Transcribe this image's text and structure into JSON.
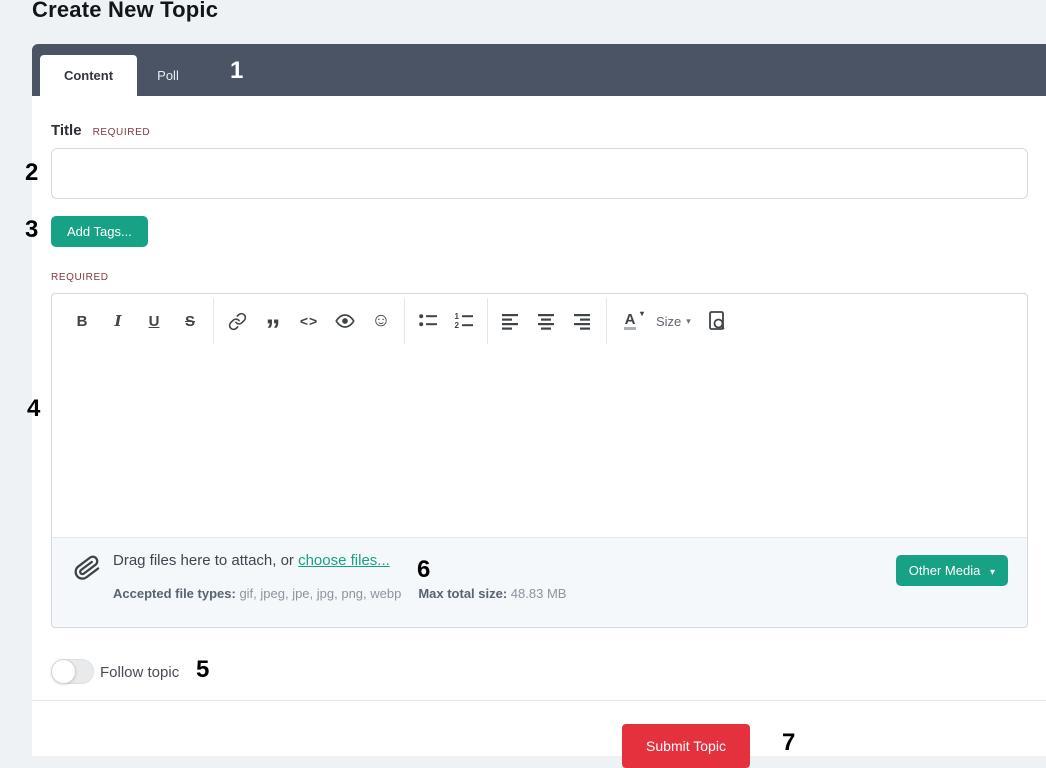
{
  "page": {
    "title": "Create New Topic"
  },
  "tabs": {
    "content_label": "Content",
    "poll_label": "Poll"
  },
  "annotations": {
    "n1": "1",
    "n2": "2",
    "n3": "3",
    "n4": "4",
    "n5": "5",
    "n6": "6",
    "n7": "7"
  },
  "form": {
    "title_label": "Title",
    "title_required_label": "REQUIRED",
    "title_value": "",
    "add_tags_button": "Add Tags...",
    "editor_required_label": "REQUIRED"
  },
  "editor": {
    "toolbar": {
      "bold": "B",
      "italic": "I",
      "underline": "U",
      "strike": "S",
      "quote_glyph": "”",
      "code_glyph": "<>",
      "emoji_glyph": "☺",
      "font_color_letter": "A",
      "size_label": "Size",
      "caret_down": "▾"
    }
  },
  "attachments": {
    "drag_text": "Drag files here to attach, or ",
    "choose_files_link": "choose files...",
    "accepted_label": "Accepted file types: ",
    "accepted_types": "gif, jpeg, jpe, jpg, png, webp",
    "max_size_label": "Max total size: ",
    "max_size_value": "48.83 MB",
    "other_media_button": "Other Media",
    "caret_down": "▾"
  },
  "follow": {
    "label": "Follow topic"
  },
  "footer": {
    "submit_button": "Submit Topic"
  },
  "icons": [
    "link-icon",
    "quote-icon",
    "code-icon",
    "eye-icon",
    "emoji-icon",
    "bulleted-list-icon",
    "numbered-list-icon",
    "align-left-icon",
    "align-center-icon",
    "align-right-icon",
    "font-color-icon",
    "preview-icon",
    "paperclip-icon",
    "caret-down-icon"
  ],
  "colors": {
    "accent_teal": "#17a285",
    "danger_red": "#e5303e",
    "tab_bar": "#4a5465",
    "required_red": "#81393f"
  }
}
